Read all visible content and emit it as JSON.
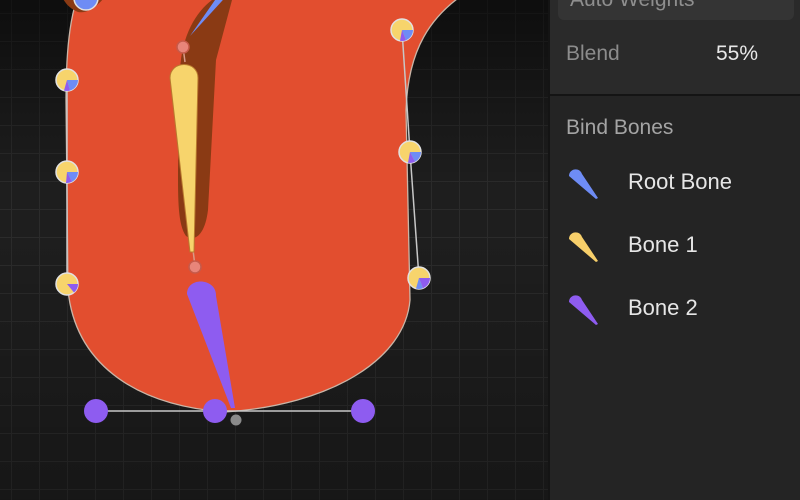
{
  "panel": {
    "weights_header": "Auto Weights",
    "blend_label": "Blend",
    "blend_value": "55%",
    "bind_bones_title": "Bind Bones",
    "bones": [
      {
        "label": "Root Bone",
        "color": "#6e8cf5",
        "icon": "bone-icon"
      },
      {
        "label": "Bone 1",
        "color": "#f7cf6a",
        "icon": "bone-icon"
      },
      {
        "label": "Bone 2",
        "color": "#8e5cf0",
        "icon": "bone-icon"
      }
    ]
  },
  "canvas": {
    "shape_color": "#e24e2f",
    "shadow_color": "#8a3a14",
    "handle_colors": {
      "yellow": "#f7d46c",
      "blue": "#6e8cf5",
      "purple": "#8e5cf0"
    }
  }
}
